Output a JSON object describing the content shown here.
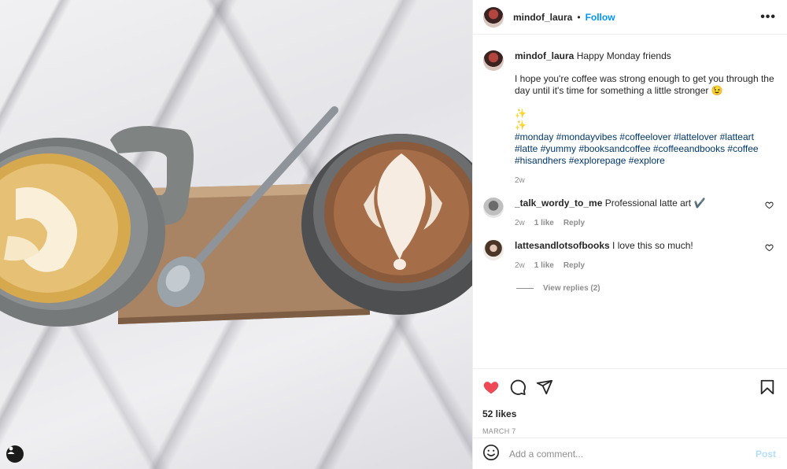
{
  "post_image": {
    "alt_description_none": ""
  },
  "header": {
    "username": "mindof_laura",
    "separator": "•",
    "follow_label": "Follow",
    "more_label": "•••"
  },
  "caption": {
    "username": "mindof_laura",
    "title": "Happy Monday friends",
    "text": "I hope you're coffee was strong enough to get you through the day until it's time for something a little stronger 😉",
    "sparkle1": "✨",
    "sparkle2": "✨",
    "hashtags": "#monday #mondayvibes #coffeelover #lattelover #latteart #latte #yummy #booksandcoffee #coffeeandbooks #coffee #hisandhers #explorepage #explore",
    "age": "2w"
  },
  "comments": [
    {
      "username": "_talk_wordy_to_me",
      "text": "Professional latte art ✔️",
      "age": "2w",
      "likes": "1 like",
      "reply": "Reply"
    },
    {
      "username": "lattesandlotsofbooks",
      "text": "I love this so much!",
      "age": "2w",
      "likes": "1 like",
      "reply": "Reply"
    }
  ],
  "view_replies": "View replies (2)",
  "likes_count": "52 likes",
  "post_date": "MARCH 7",
  "add_comment": {
    "placeholder": "Add a comment...",
    "post_label": "Post"
  },
  "colors": {
    "accent": "#0095f6",
    "liked": "#ed4956",
    "hashtag": "#00376b",
    "muted": "#8e8e8e"
  },
  "icons": [
    "heart-icon",
    "comment-icon",
    "share-icon",
    "bookmark-icon",
    "emoji-icon",
    "user-tag-icon"
  ]
}
